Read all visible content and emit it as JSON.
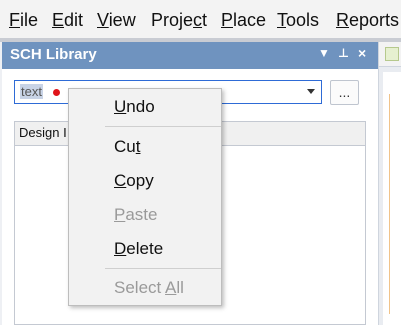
{
  "menubar": {
    "items": [
      {
        "pre": "",
        "u": "F",
        "post": "ile"
      },
      {
        "pre": "",
        "u": "E",
        "post": "dit"
      },
      {
        "pre": "",
        "u": "V",
        "post": "iew"
      },
      {
        "pre": "Proje",
        "u": "c",
        "post": "t"
      },
      {
        "pre": "",
        "u": "P",
        "post": "lace"
      },
      {
        "pre": "",
        "u": "T",
        "post": "ools"
      },
      {
        "pre": "",
        "u": "R",
        "post": "eports"
      }
    ]
  },
  "panel": {
    "title": "SCH Library",
    "buttons": {
      "dropdown": "▼",
      "pin": "⊥",
      "close": "×"
    },
    "search": {
      "value": "text"
    },
    "ellipsis_label": "...",
    "grid": {
      "columns": [
        "Design I",
        "on"
      ]
    }
  },
  "context_menu": {
    "items": [
      {
        "pre": "",
        "u": "U",
        "post": "ndo",
        "enabled": true
      },
      {
        "pre": "Cu",
        "u": "t",
        "post": "",
        "enabled": true
      },
      {
        "pre": "",
        "u": "C",
        "post": "opy",
        "enabled": true
      },
      {
        "pre": "",
        "u": "P",
        "post": "aste",
        "enabled": false
      },
      {
        "pre": "",
        "u": "D",
        "post": "elete",
        "enabled": true
      },
      {
        "pre": "Select ",
        "u": "A",
        "post": "ll",
        "enabled": false
      }
    ]
  },
  "colors": {
    "panel_title_bg": "#6f93bf",
    "focus_border": "#2e6bd6",
    "red_marker": "#e0141a"
  }
}
